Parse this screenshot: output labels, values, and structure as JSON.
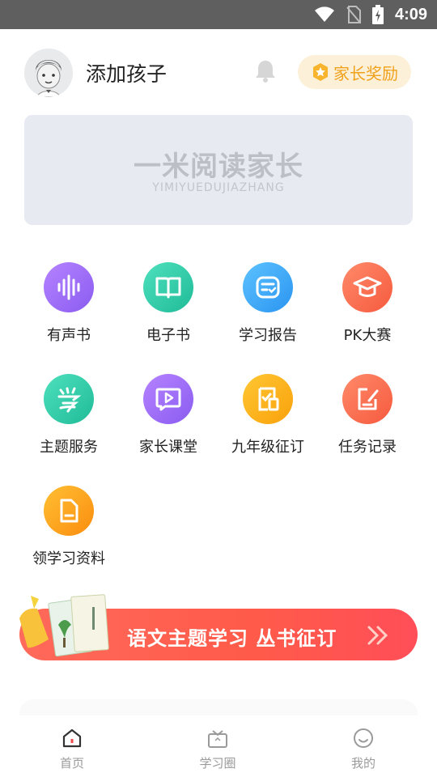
{
  "status_bar": {
    "time": "4:09"
  },
  "header": {
    "title": "添加孩子",
    "reward_label": "家长奖励"
  },
  "banner": {
    "logo": "一米阅读家长",
    "subtitle": "YIMIYUEDUJIAZHANG"
  },
  "grid": [
    {
      "label": "有声书",
      "icon": "audio-wave-icon",
      "color": "#9b6cf4"
    },
    {
      "label": "电子书",
      "icon": "open-book-icon",
      "color": "#2dcaa6"
    },
    {
      "label": "学习报告",
      "icon": "report-icon",
      "color": "#3aa7f7"
    },
    {
      "label": "PK大赛",
      "icon": "graduation-cap-icon",
      "color": "#fb6c4f"
    },
    {
      "label": "主题服务",
      "icon": "study-character-icon",
      "color": "#2dcaa6"
    },
    {
      "label": "家长课堂",
      "icon": "video-play-icon",
      "color": "#9b6cf4"
    },
    {
      "label": "九年级征订",
      "icon": "order-check-icon",
      "color": "#fbb01a"
    },
    {
      "label": "任务记录",
      "icon": "task-edit-icon",
      "color": "#fb6c4f"
    },
    {
      "label": "领学习资料",
      "icon": "folder-icon",
      "color": "#fb9e1a"
    }
  ],
  "promo": {
    "text": "语文主题学习  丛书征订"
  },
  "tabbar": [
    {
      "label": "首页",
      "icon": "home-icon"
    },
    {
      "label": "学习圈",
      "icon": "study-circle-icon"
    },
    {
      "label": "我的",
      "icon": "profile-smile-icon"
    }
  ]
}
